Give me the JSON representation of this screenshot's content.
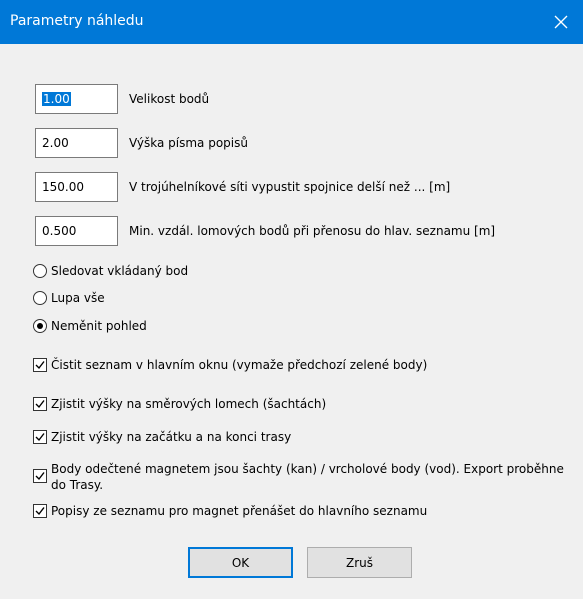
{
  "window": {
    "title": "Parametry náhledu"
  },
  "fields": [
    {
      "value": "1.00",
      "label": "Velikost bodů"
    },
    {
      "value": "2.00",
      "label": "Výška písma popisů"
    },
    {
      "value": "150.00",
      "label": "V trojúhelníkové síti vypustit spojnice delší než ... [m]"
    },
    {
      "value": "0.500",
      "label": "Min. vzdál. lomových bodů při přenosu do hlav. seznamu [m]"
    }
  ],
  "radios": [
    {
      "label": "Sledovat vkládaný bod",
      "checked": false
    },
    {
      "label": "Lupa vše",
      "checked": false
    },
    {
      "label": "Neměnit pohled",
      "checked": true
    }
  ],
  "checkboxes": [
    {
      "label": "Čistit seznam v hlavním oknu (vymaže předchozí zelené body)",
      "checked": true
    },
    {
      "label": "Zjistit výšky na směrových lomech (šachtách)",
      "checked": true
    },
    {
      "label": "Zjistit výšky na začátku a na konci trasy",
      "checked": true
    },
    {
      "label": "Body odečtené magnetem jsou šachty (kan) / vrcholové body (vod). Export proběhne do Trasy.",
      "checked": true
    },
    {
      "label": "Popisy ze seznamu pro magnet přenášet do hlavního seznamu",
      "checked": true
    }
  ],
  "buttons": {
    "ok": "OK",
    "cancel": "Zruš"
  },
  "colors": {
    "titlebar": "#0078d7",
    "selection": "#0078d7",
    "background": "#f0f0f0"
  }
}
